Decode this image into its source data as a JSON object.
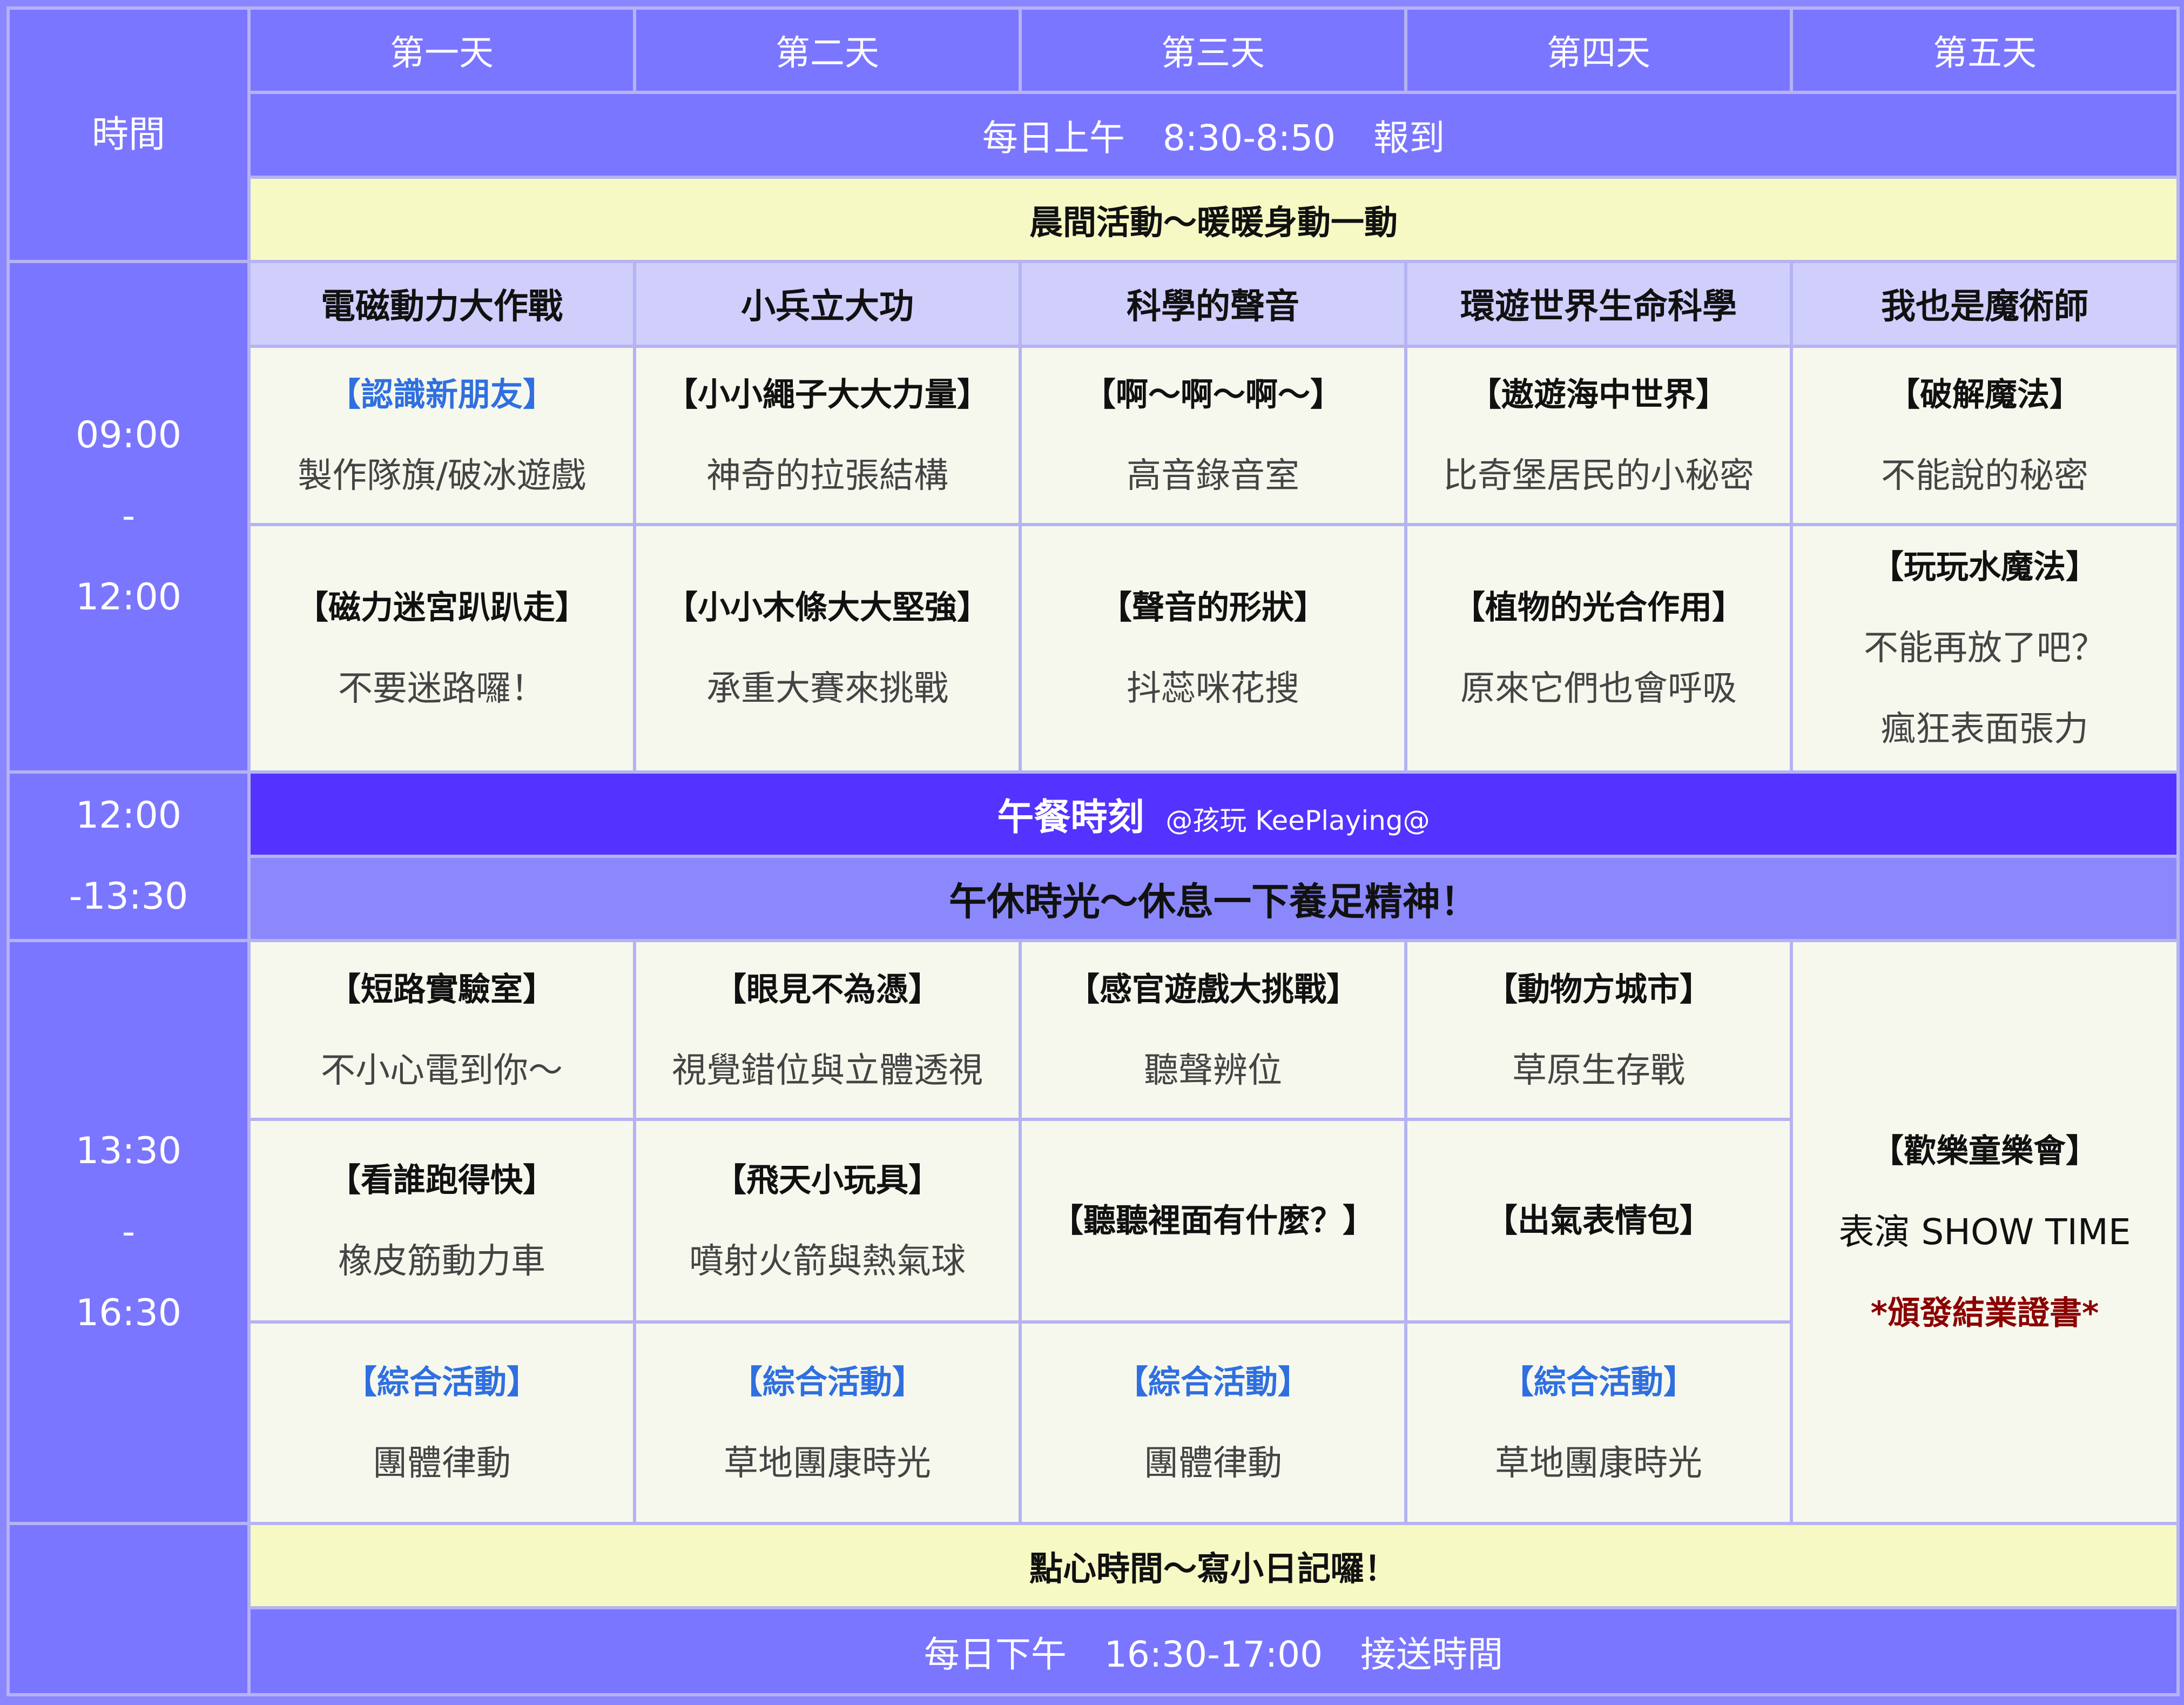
{
  "header": {
    "time_label": "時間",
    "days": [
      "第一天",
      "第二天",
      "第三天",
      "第四天",
      "第五天"
    ]
  },
  "checkin": {
    "prefix": "每日上午",
    "time": "8:30-8:50",
    "label": "報到"
  },
  "morning_activity": "晨間活動～暖暖身動一動",
  "themes": [
    "電磁動力大作戰",
    "小兵立大功",
    "科學的聲音",
    "環遊世界生命科學",
    "我也是魔術師"
  ],
  "morning": {
    "time": {
      "start": "09:00",
      "sep": "-",
      "end": "12:00"
    },
    "row1": [
      {
        "title": "【認識新朋友】",
        "desc": "製作隊旗/破冰遊戲",
        "title_color": "#2f6fe0"
      },
      {
        "title": "【小小繩子大大力量】",
        "desc": "神奇的拉張結構"
      },
      {
        "title": "【啊～啊～啊～】",
        "desc": "高音錄音室"
      },
      {
        "title": "【遨遊海中世界】",
        "desc": "比奇堡居民的小秘密"
      },
      {
        "title": "【破解魔法】",
        "desc": "不能說的秘密"
      }
    ],
    "row2": [
      {
        "title": "【磁力迷宮趴趴走】",
        "desc": "不要迷路囉！"
      },
      {
        "title": "【小小木條大大堅強】",
        "desc": "承重大賽來挑戰"
      },
      {
        "title": "【聲音的形狀】",
        "desc": "抖蕊咪花搜"
      },
      {
        "title": "【植物的光合作用】",
        "desc": "原來它們也會呼吸"
      },
      {
        "title": "【玩玩水魔法】",
        "desc": "不能再放了吧？",
        "desc2": "瘋狂表面張力"
      }
    ]
  },
  "lunch": {
    "time": {
      "start": "12:00",
      "end": "-13:30"
    },
    "title": "午餐時刻",
    "credit": "@孩玩 KeePlaying@",
    "rest": "午休時光～休息一下養足精神！"
  },
  "afternoon": {
    "time": {
      "start": "13:30",
      "sep": "-",
      "end": "16:30"
    },
    "row1": [
      {
        "title": "【短路實驗室】",
        "desc": "不小心電到你～"
      },
      {
        "title": "【眼見不為憑】",
        "desc": "視覺錯位與立體透視"
      },
      {
        "title": "【感官遊戲大挑戰】",
        "desc": "聽聲辨位"
      },
      {
        "title": "【動物方城市】",
        "desc": "草原生存戰"
      }
    ],
    "row2": [
      {
        "title": "【看誰跑得快】",
        "desc": "橡皮筋動力車"
      },
      {
        "title": "【飛天小玩具】",
        "desc": "噴射火箭與熱氣球"
      },
      {
        "title": "【聽聽裡面有什麼？】"
      },
      {
        "title": "【出氣表情包】"
      }
    ],
    "row3": [
      {
        "title": "【綜合活動】",
        "desc": "團體律動"
      },
      {
        "title": "【綜合活動】",
        "desc": "草地團康時光"
      },
      {
        "title": "【綜合活動】",
        "desc": "團體律動"
      },
      {
        "title": "【綜合活動】",
        "desc": "草地團康時光"
      }
    ],
    "finale": {
      "title": "【歡樂童樂會】",
      "show": "表演 SHOW TIME",
      "note": "*頒發結業證書*"
    }
  },
  "snack": "點心時間～寫小日記囉！",
  "pickup": {
    "prefix": "每日下午",
    "time": "16:30-17:00",
    "label": "接送時間"
  },
  "colors": {
    "band": "#7b76ff",
    "lunch": "#5432ff",
    "highlight_title": "#2f6fe0",
    "note": "#8b0000",
    "yellow": "#f7f9c5",
    "theme": "#d0cffc"
  }
}
